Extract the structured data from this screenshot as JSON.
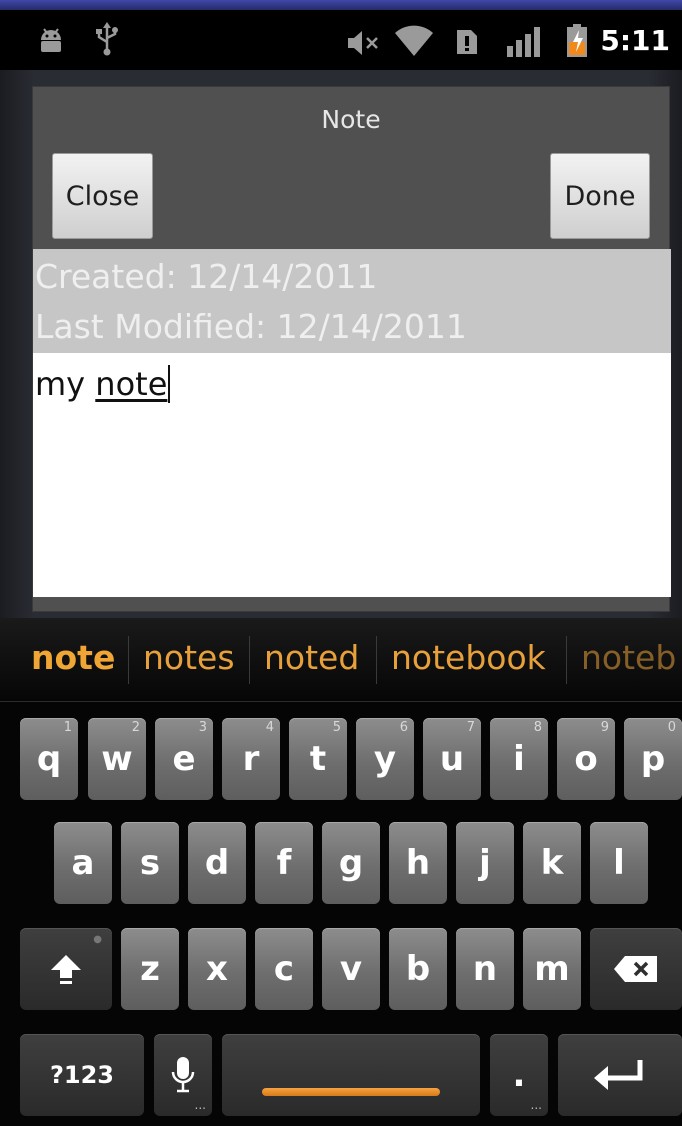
{
  "status_bar": {
    "time": "5:11",
    "left_icons": [
      "android-debug-icon",
      "usb-icon"
    ],
    "right_icons": [
      "volume-muted-icon",
      "wifi-icon",
      "sim-alert-icon",
      "signal-icon",
      "battery-charging-icon"
    ]
  },
  "dialog": {
    "title": "Note",
    "close_label": "Close",
    "done_label": "Done",
    "created_text": "Created:  12/14/2011",
    "modified_text": "Last Modified: 12/14/2011",
    "body_text_plain": "my ",
    "body_text_composing": "note"
  },
  "suggestions": {
    "items": [
      "note",
      "notes",
      "noted",
      "notebook",
      "noteb"
    ]
  },
  "keyboard": {
    "row1": [
      {
        "label": "q",
        "hint": "1"
      },
      {
        "label": "w",
        "hint": "2"
      },
      {
        "label": "e",
        "hint": "3"
      },
      {
        "label": "r",
        "hint": "4"
      },
      {
        "label": "t",
        "hint": "5"
      },
      {
        "label": "y",
        "hint": "6"
      },
      {
        "label": "u",
        "hint": "7"
      },
      {
        "label": "i",
        "hint": "8"
      },
      {
        "label": "o",
        "hint": "9"
      },
      {
        "label": "p",
        "hint": "0"
      }
    ],
    "row2": [
      "a",
      "s",
      "d",
      "f",
      "g",
      "h",
      "j",
      "k",
      "l"
    ],
    "row3": [
      "z",
      "x",
      "c",
      "v",
      "b",
      "n",
      "m"
    ],
    "symbols_label": "?123",
    "period_label": ".",
    "accent_color": "#e8a13a"
  }
}
